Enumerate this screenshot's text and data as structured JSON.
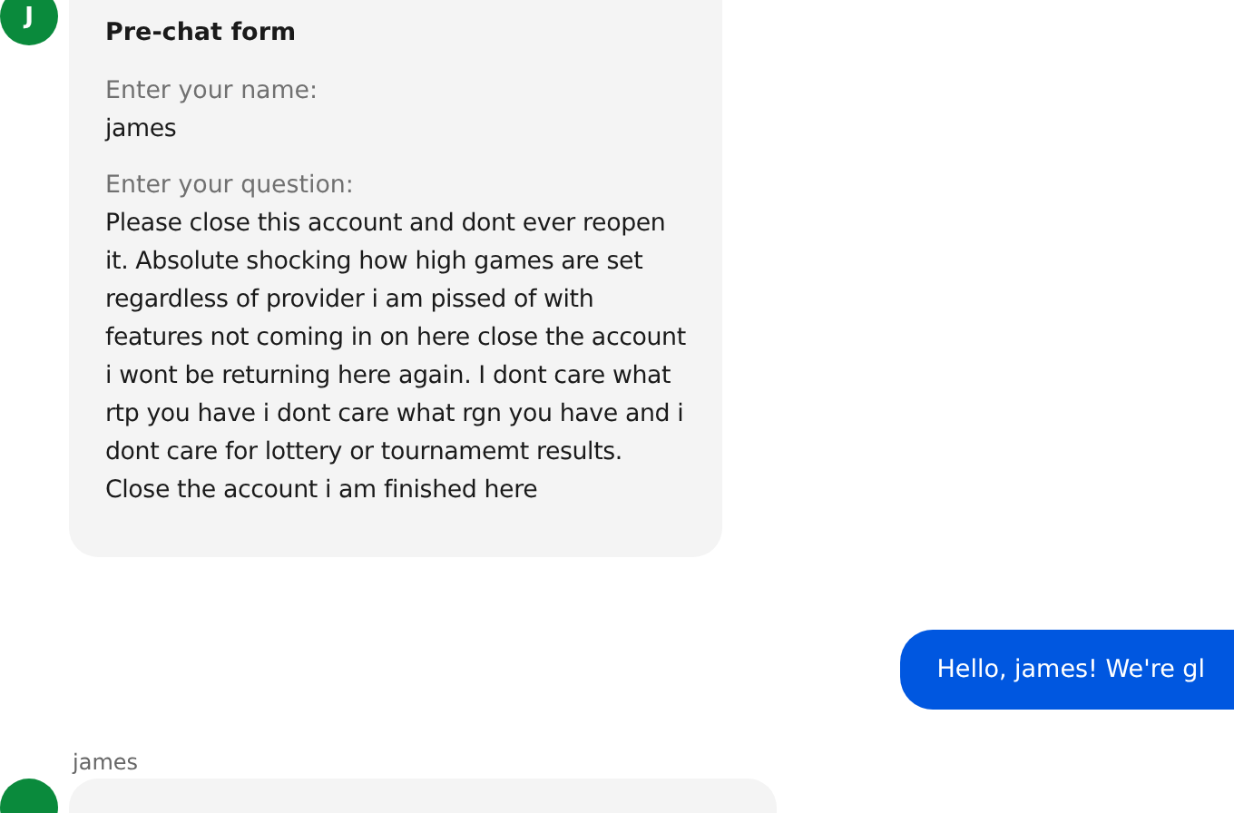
{
  "messages": [
    {
      "kind": "form",
      "avatar": "J",
      "title": "Pre-chat form",
      "fields": [
        {
          "label": "Enter your name:",
          "value": "james"
        },
        {
          "label": "Enter your question:",
          "value": "Please close this account and dont ever reopen it. Absolute shocking how high games are set regardless of provider i am pissed of with features not coming in on here close the account i wont be returning here again. I dont care what rtp you have i dont care what rgn you have and i dont care for lottery or tournamemt results. Close the account i am finished here"
        }
      ]
    },
    {
      "kind": "outgoing",
      "text": "Hello, james! We're gl"
    },
    {
      "kind": "incoming",
      "sender": "james"
    }
  ]
}
